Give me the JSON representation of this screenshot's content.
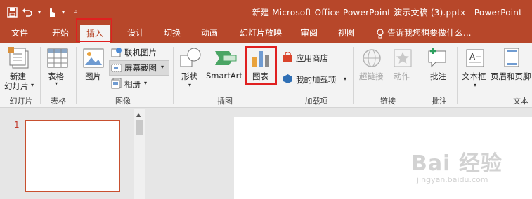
{
  "titlebar": {
    "title": "新建 Microsoft Office PowerPoint 演示文稿 (3).pptx - PowerPoint",
    "qat": [
      "save-icon",
      "undo-icon",
      "touch-mode-icon",
      "customize-qat-icon"
    ]
  },
  "tabs": [
    {
      "label": "文件"
    },
    {
      "label": "开始"
    },
    {
      "label": "插入",
      "active": true
    },
    {
      "label": "设计"
    },
    {
      "label": "切换"
    },
    {
      "label": "动画"
    },
    {
      "label": "幻灯片放映"
    },
    {
      "label": "审阅"
    },
    {
      "label": "视图"
    }
  ],
  "tell_me": "告诉我您想要做什么...",
  "ribbon": {
    "slides": {
      "new_slide_line1": "新建",
      "new_slide_line2": "幻灯片",
      "group": "幻灯片"
    },
    "tables": {
      "table": "表格",
      "group": "表格"
    },
    "images": {
      "picture": "图片",
      "online_picture": "联机图片",
      "screenshot": "屏幕截图",
      "album": "相册",
      "group": "图像"
    },
    "illustrations": {
      "shapes": "形状",
      "smartart": "SmartArt",
      "chart": "图表",
      "group": "插图"
    },
    "addins": {
      "store": "应用商店",
      "my_addins": "我的加载项",
      "group": "加载项"
    },
    "links": {
      "hyperlink": "超链接",
      "action": "动作",
      "group": "链接"
    },
    "comments": {
      "comment": "批注",
      "group": "批注"
    },
    "text": {
      "textbox": "文本框",
      "header_footer": "页眉和页脚",
      "group": "文本"
    }
  },
  "slides_pane": {
    "slide_number": "1"
  },
  "watermark": {
    "main": "Bai 经验",
    "sub": "jingyan.baidu.com"
  },
  "colors": {
    "accent": "#b7472a",
    "highlight_box": "#e02020"
  }
}
